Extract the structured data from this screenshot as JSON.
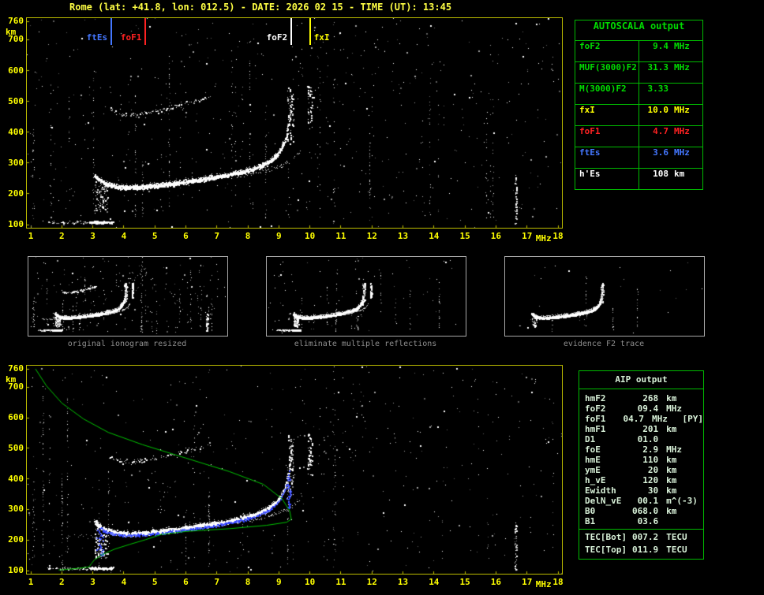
{
  "title": "Rome (lat: +41.8, lon: 012.5) - DATE: 2026 02 15 - TIME (UT): 13:45",
  "colors": {
    "axis_yellow": "#ffff00",
    "title_yellow": "#ffff44",
    "table_green": "#00bb00",
    "text_green": "#00dd00",
    "trace_white": "#ffffff",
    "profile_green": "#00c400",
    "scaled_trace_blue": "#3344ff",
    "marker_red": "#ff2222",
    "marker_blue": "#4477ff",
    "caption_gray": "#8f8f8f"
  },
  "plots": {
    "x_unit": "MHz",
    "y_unit": "km",
    "x_ticks": [
      1,
      2,
      3,
      4,
      5,
      6,
      7,
      8,
      9,
      10,
      11,
      12,
      13,
      14,
      15,
      16,
      17,
      18
    ],
    "y_ticks": [
      760,
      700,
      600,
      500,
      400,
      300,
      200,
      100
    ]
  },
  "markers": [
    {
      "label": "ftEs",
      "freq_mhz": 3.6,
      "color": "#4477ff",
      "side": "left"
    },
    {
      "label": "foF1",
      "freq_mhz": 4.7,
      "color": "#ff2222",
      "side": "left"
    },
    {
      "label": "foF2",
      "freq_mhz": 9.4,
      "color": "#ffffff",
      "side": "left"
    },
    {
      "label": "fxI",
      "freq_mhz": 10.0,
      "color": "#ffff00",
      "side": "right"
    }
  ],
  "autoscala_table": {
    "header": "AUTOSCALA output",
    "rows": [
      {
        "label": "foF2",
        "value": "9.4",
        "unit": "MHz",
        "color": "#00dd00"
      },
      {
        "label": "MUF(3000)F2",
        "value": "31.3",
        "unit": "MHz",
        "color": "#00dd00"
      },
      {
        "label": "M(3000)F2",
        "value": "3.33",
        "unit": "",
        "color": "#00dd00"
      },
      {
        "label": "fxI",
        "value": "10.0",
        "unit": "MHz",
        "color": "#ffff00"
      },
      {
        "label": "foF1",
        "value": "4.7",
        "unit": "MHz",
        "color": "#ff2222"
      },
      {
        "label": "ftEs",
        "value": "3.6",
        "unit": "MHz",
        "color": "#4477ff"
      },
      {
        "label": "h'Es",
        "value": "108",
        "unit": "km",
        "color": "#ffffff"
      }
    ]
  },
  "thumbnails": [
    {
      "caption": "original ionogram resized"
    },
    {
      "caption": "eliminate multiple reflections"
    },
    {
      "caption": "evidence F2 trace"
    }
  ],
  "aip_table": {
    "header": "AIP output",
    "rows": [
      {
        "label": "hmF2",
        "value": "268",
        "unit": "km",
        "extra": ""
      },
      {
        "label": "foF2",
        "value": "09.4",
        "unit": "MHz",
        "extra": ""
      },
      {
        "label": "foF1",
        "value": "04.7",
        "unit": "MHz",
        "extra": "[PY]"
      },
      {
        "label": "hmF1",
        "value": "201",
        "unit": "km",
        "extra": ""
      },
      {
        "label": "D1",
        "value": "01.0",
        "unit": "",
        "extra": ""
      },
      {
        "label": "foE",
        "value": "2.9",
        "unit": "MHz",
        "extra": ""
      },
      {
        "label": "hmE",
        "value": "110",
        "unit": "km",
        "extra": ""
      },
      {
        "label": "ymE",
        "value": "20",
        "unit": "km",
        "extra": ""
      },
      {
        "label": "h_vE",
        "value": "120",
        "unit": "km",
        "extra": ""
      },
      {
        "label": "Ewidth",
        "value": "30",
        "unit": "km",
        "extra": ""
      },
      {
        "label": "DelN_vE",
        "value": "00.1",
        "unit": "m^(-3)",
        "extra": ""
      },
      {
        "label": "B0",
        "value": "068.0",
        "unit": "km",
        "extra": ""
      },
      {
        "label": "B1",
        "value": "03.6",
        "unit": "",
        "extra": ""
      },
      {
        "label": "TEC[Bot]",
        "value": "007.2",
        "unit": "TECU",
        "extra": "",
        "sep": true
      },
      {
        "label": "TEC[Top]",
        "value": "011.9",
        "unit": "TECU",
        "extra": ""
      }
    ]
  },
  "chart_data": {
    "type": "scatter",
    "title": "Vertical incidence ionogram, Rome, 2026-02-15 13:45 UT",
    "xlabel": "MHz",
    "ylabel": "km",
    "x_range": [
      1,
      18
    ],
    "y_range": [
      100,
      760
    ],
    "grid": false,
    "scaled_parameters": {
      "foF2_mhz": 9.4,
      "MUF3000F2_mhz": 31.3,
      "M3000F2": 3.33,
      "fxI_mhz": 10.0,
      "foF1_mhz": 4.7,
      "ftEs_mhz": 3.6,
      "hEs_km": 108,
      "hmF2_km": 268,
      "hmF1_km": 201,
      "hmE_km": 110,
      "foE_mhz": 2.9
    },
    "traces": {
      "Es_layer": {
        "freq_mhz": [
          1.6,
          3.6
        ],
        "height_km": [
          103,
          110
        ]
      },
      "F_trace_points_mhz_km": [
        [
          3.2,
          246
        ],
        [
          4,
          221
        ],
        [
          5,
          230
        ],
        [
          6,
          243
        ],
        [
          7,
          254
        ],
        [
          8,
          276
        ],
        [
          8.5,
          294
        ],
        [
          9,
          334
        ],
        [
          9.3,
          412
        ],
        [
          9.4,
          540
        ]
      ],
      "x_trace_asymptote": {
        "freq_mhz": 10.0,
        "height_km": [
          410,
          550
        ]
      },
      "second_hop_F_mhz_km": [
        [
          3.6,
          480
        ],
        [
          4.5,
          465
        ],
        [
          5.5,
          470
        ],
        [
          6.5,
          505
        ]
      ]
    },
    "electron_density_profile_mhz_km": [
      [
        1.15,
        760
      ],
      [
        1.5,
        705
      ],
      [
        2.0,
        648
      ],
      [
        2.7,
        596
      ],
      [
        3.5,
        552
      ],
      [
        4.6,
        512
      ],
      [
        6.0,
        468
      ],
      [
        7.4,
        424
      ],
      [
        8.5,
        382
      ],
      [
        9.1,
        335
      ],
      [
        9.35,
        295
      ],
      [
        9.4,
        268
      ],
      [
        9.25,
        258
      ],
      [
        8.6,
        248
      ],
      [
        7.4,
        237
      ],
      [
        6.0,
        228
      ],
      [
        5.2,
        218
      ],
      [
        4.7,
        201
      ],
      [
        4.2,
        186
      ],
      [
        3.7,
        170
      ],
      [
        3.3,
        152
      ],
      [
        3.05,
        135
      ],
      [
        2.95,
        122
      ],
      [
        2.88,
        112
      ],
      [
        2.6,
        108
      ],
      [
        2.2,
        104
      ],
      [
        1.9,
        102
      ]
    ],
    "legend_position": "none"
  }
}
